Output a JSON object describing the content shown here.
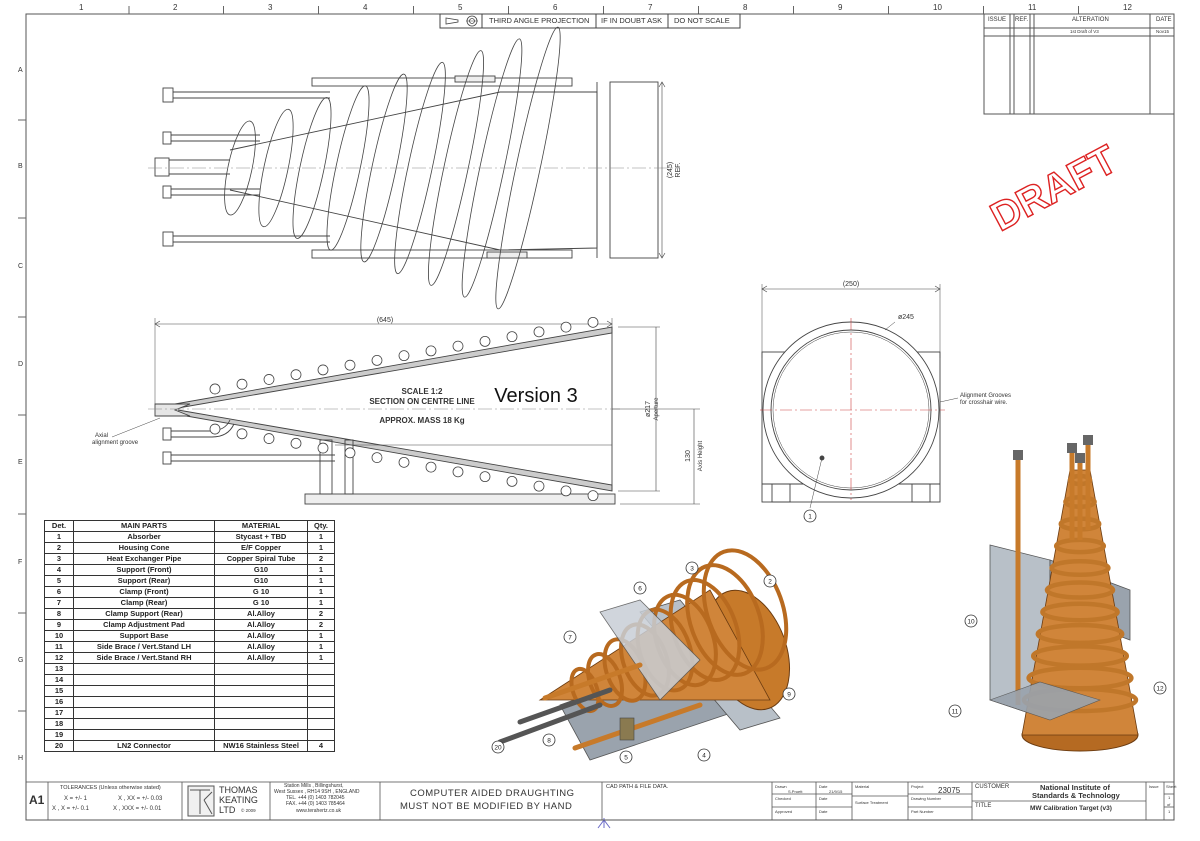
{
  "border": {
    "cols": [
      "1",
      "2",
      "3",
      "4",
      "5",
      "6",
      "7",
      "8",
      "9",
      "10",
      "11",
      "12"
    ],
    "rows": [
      "A",
      "B",
      "C",
      "D",
      "E",
      "F",
      "G",
      "H"
    ]
  },
  "header": {
    "projection": "THIRD ANGLE PROJECTION",
    "doubt": "IF IN DOUBT ASK",
    "noscale": "DO NOT SCALE"
  },
  "revision": {
    "issue": "ISSUE",
    "ref": "REF.",
    "alteration": "ALTERATION",
    "date": "DATE",
    "row_alteration": "1st Draft of V3",
    "row_date": "Nov15"
  },
  "stamp": "DRAFT",
  "views": {
    "ref_dim": "(245)",
    "ref_label": "REF.",
    "length_dim": "(645)",
    "scale": "SCALE 1:2",
    "section": "SECTION ON CENTRE LINE",
    "mass": "APPROX. MASS 18 Kg",
    "version": "Version 3",
    "aperture_dim": "ø217",
    "aperture_label": "Aperture",
    "axis_dim": "130",
    "axis_label": "Axis Height",
    "width_dim": "(250)",
    "dia_dim": "ø245",
    "grooves_note_1": "Alignment Grooves",
    "grooves_note_2": "for crosshair wire.",
    "tip_note_1": "Axial",
    "tip_note_2": "alignment groove"
  },
  "bom": {
    "headers": [
      "Det.",
      "MAIN PARTS",
      "MATERIAL",
      "Qty."
    ],
    "rows": [
      [
        "1",
        "Absorber",
        "Stycast + TBD",
        "1"
      ],
      [
        "2",
        "Housing Cone",
        "E/F Copper",
        "1"
      ],
      [
        "3",
        "Heat Exchanger Pipe",
        "Copper Spiral Tube",
        "2"
      ],
      [
        "4",
        "Support (Front)",
        "G10",
        "1"
      ],
      [
        "5",
        "Support (Rear)",
        "G10",
        "1"
      ],
      [
        "6",
        "Clamp (Front)",
        "G 10",
        "1"
      ],
      [
        "7",
        "Clamp (Rear)",
        "G 10",
        "1"
      ],
      [
        "8",
        "Clamp Support (Rear)",
        "Al.Alloy",
        "2"
      ],
      [
        "9",
        "Clamp Adjustment Pad",
        "Al.Alloy",
        "2"
      ],
      [
        "10",
        "Support Base",
        "Al.Alloy",
        "1"
      ],
      [
        "11",
        "Side Brace / Vert.Stand LH",
        "Al.Alloy",
        "1"
      ],
      [
        "12",
        "Side Brace / Vert.Stand RH",
        "Al.Alloy",
        "1"
      ],
      [
        "13",
        "",
        "",
        ""
      ],
      [
        "14",
        "",
        "",
        ""
      ],
      [
        "15",
        "",
        "",
        ""
      ],
      [
        "16",
        "",
        "",
        ""
      ],
      [
        "17",
        "",
        "",
        ""
      ],
      [
        "18",
        "",
        "",
        ""
      ],
      [
        "19",
        "",
        "",
        ""
      ],
      [
        "20",
        "LN2 Connector",
        "NW16 Stainless Steel",
        "4"
      ]
    ]
  },
  "balloons": {
    "front": "1",
    "iso1": [
      "2",
      "3",
      "4",
      "5",
      "6",
      "7",
      "8",
      "9",
      "20"
    ],
    "iso2": [
      "10",
      "11",
      "12"
    ]
  },
  "titleblock": {
    "sheet_size": "A1",
    "tol_title": "TOLERANCES (Unless otherwise stated)",
    "tol_1": "X = +/- 1",
    "tol_2": "X , XX = +/- 0.03",
    "tol_3": "X , X = +/- 0.1",
    "tol_4": "X , XXX = +/- 0.01",
    "company_1": "THOMAS",
    "company_2": "KEATING",
    "company_3": "LTD",
    "copyright": "© 2009",
    "addr_1": "Station Mills , Billingshurst,",
    "addr_2": "West Sussex , RH14 9SH , ENGLAND",
    "addr_3": "TEL. +44 (0) 1403 782045",
    "addr_4": "FAX. +44 (0) 1403 785464",
    "addr_5": "www.terahertz.co.uk",
    "cad_1": "COMPUTER AIDED DRAUGHTING",
    "cad_2": "MUST NOT BE MODIFIED BY HAND",
    "cad_path": "CAD PATH & FILE DATA.",
    "drawn": "Drawn",
    "drawn_by": "S.Pruett",
    "date_lbl": "Date",
    "drawn_date": "21/9/15",
    "checked": "Checked",
    "approved": "Approved",
    "material": "Material",
    "surface": "Surface Treatment",
    "project_lbl": "Project",
    "project": "23075",
    "drawing_no": "Drawing Number",
    "part_no": "Part Number",
    "customer_lbl": "CUSTOMER",
    "customer_1": "National Institute of",
    "customer_2": "Standards & Technology",
    "title_lbl": "TITLE",
    "title": "MW Calibration Target (v3)",
    "issue": "Issue",
    "sheet": "Sheet",
    "sheet_no": "1",
    "of": "of",
    "sheet_total": "1"
  }
}
